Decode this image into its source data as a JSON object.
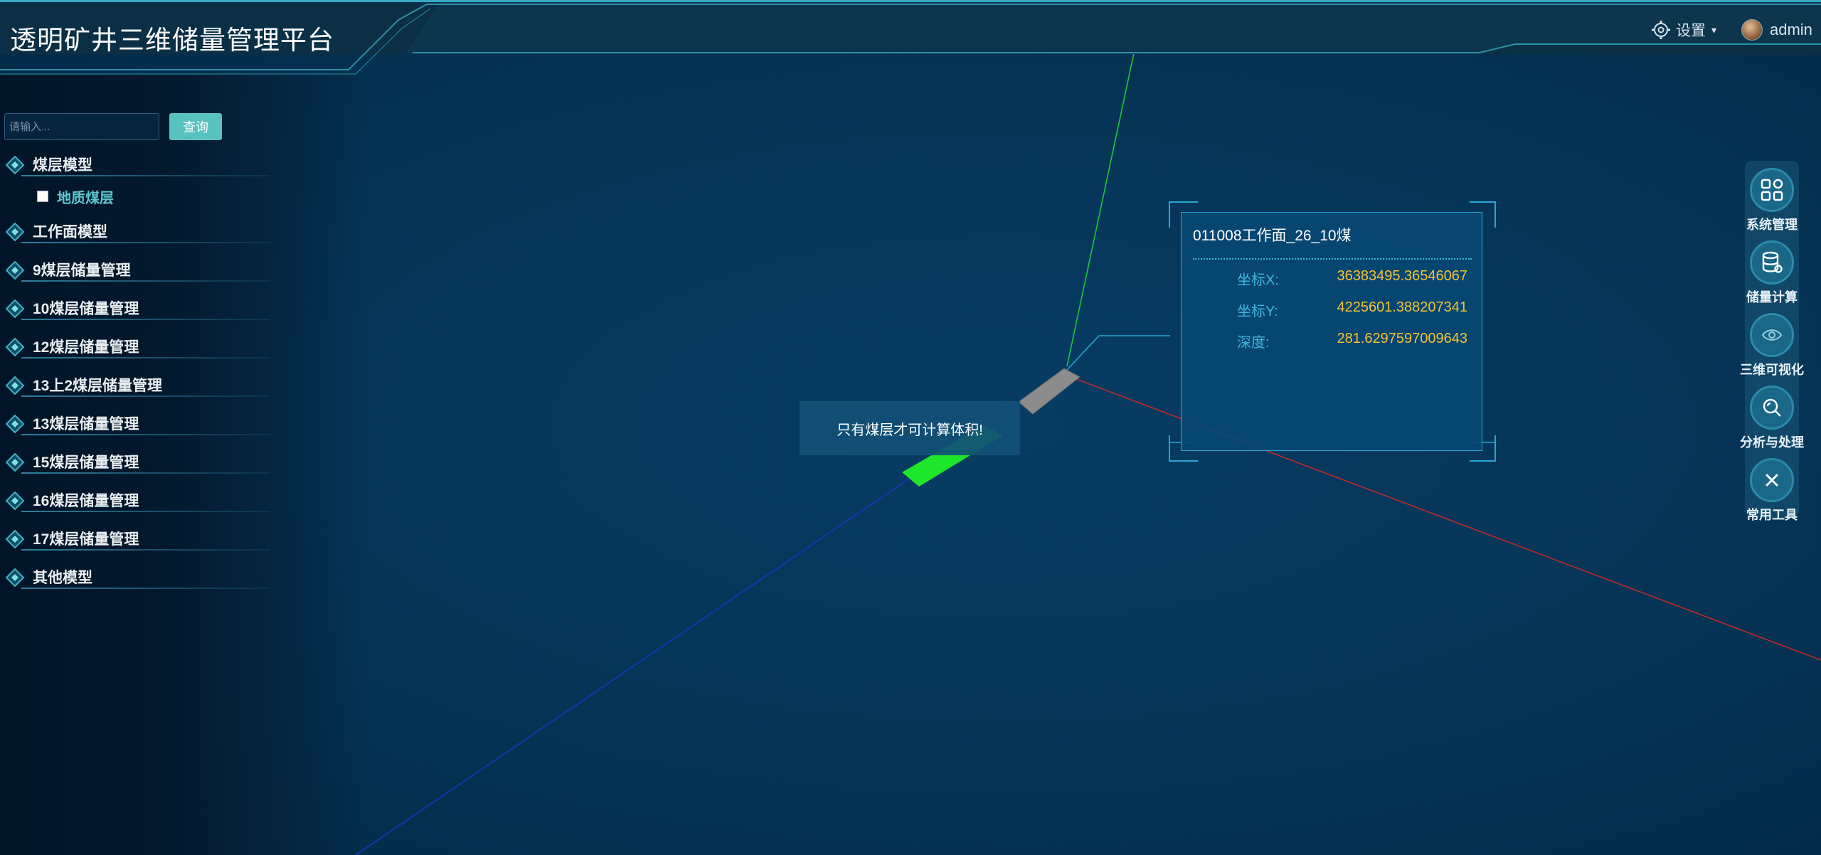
{
  "header": {
    "title": "透明矿井三维储量管理平台",
    "settings_label": "设置",
    "user_name": "admin"
  },
  "sidebar": {
    "search": {
      "placeholder": "请输入...",
      "button_label": "查询"
    },
    "tree": [
      {
        "label": "煤层模型",
        "children": [
          {
            "label": "地质煤层",
            "checked": false
          }
        ]
      },
      {
        "label": "工作面模型"
      },
      {
        "label": "9煤层储量管理"
      },
      {
        "label": "10煤层储量管理"
      },
      {
        "label": "12煤层储量管理"
      },
      {
        "label": "13上2煤层储量管理"
      },
      {
        "label": "13煤层储量管理"
      },
      {
        "label": "15煤层储量管理"
      },
      {
        "label": "16煤层储量管理"
      },
      {
        "label": "17煤层储量管理"
      },
      {
        "label": "其他模型"
      }
    ]
  },
  "scene": {
    "tooltip": "只有煤层才可计算体积!",
    "axis_colors": {
      "x": "#c0282b",
      "y": "#22c43a",
      "z": "#1336b8"
    },
    "selected_color": "#1ee62a",
    "model_color": "#8c8c8c"
  },
  "info_panel": {
    "title": "011008工作面_26_10煤",
    "rows": [
      {
        "label": "坐标X:",
        "value": "36383495.36546067"
      },
      {
        "label": "坐标Y:",
        "value": "4225601.388207341"
      },
      {
        "label": "深度:",
        "value": "281.6297597009643"
      }
    ]
  },
  "toolbar": [
    {
      "label": "系统管理",
      "icon": "grid-icon"
    },
    {
      "label": "储量计算",
      "icon": "database-icon"
    },
    {
      "label": "三维可视化",
      "icon": "eye-icon"
    },
    {
      "label": "分析与处理",
      "icon": "magnify-icon"
    },
    {
      "label": "常用工具",
      "icon": "close-icon"
    }
  ],
  "colors": {
    "accent": "#57c2c0",
    "panel_border": "#2aa5d2",
    "value_text": "#f2c233",
    "label_text": "#3fb6dd"
  }
}
